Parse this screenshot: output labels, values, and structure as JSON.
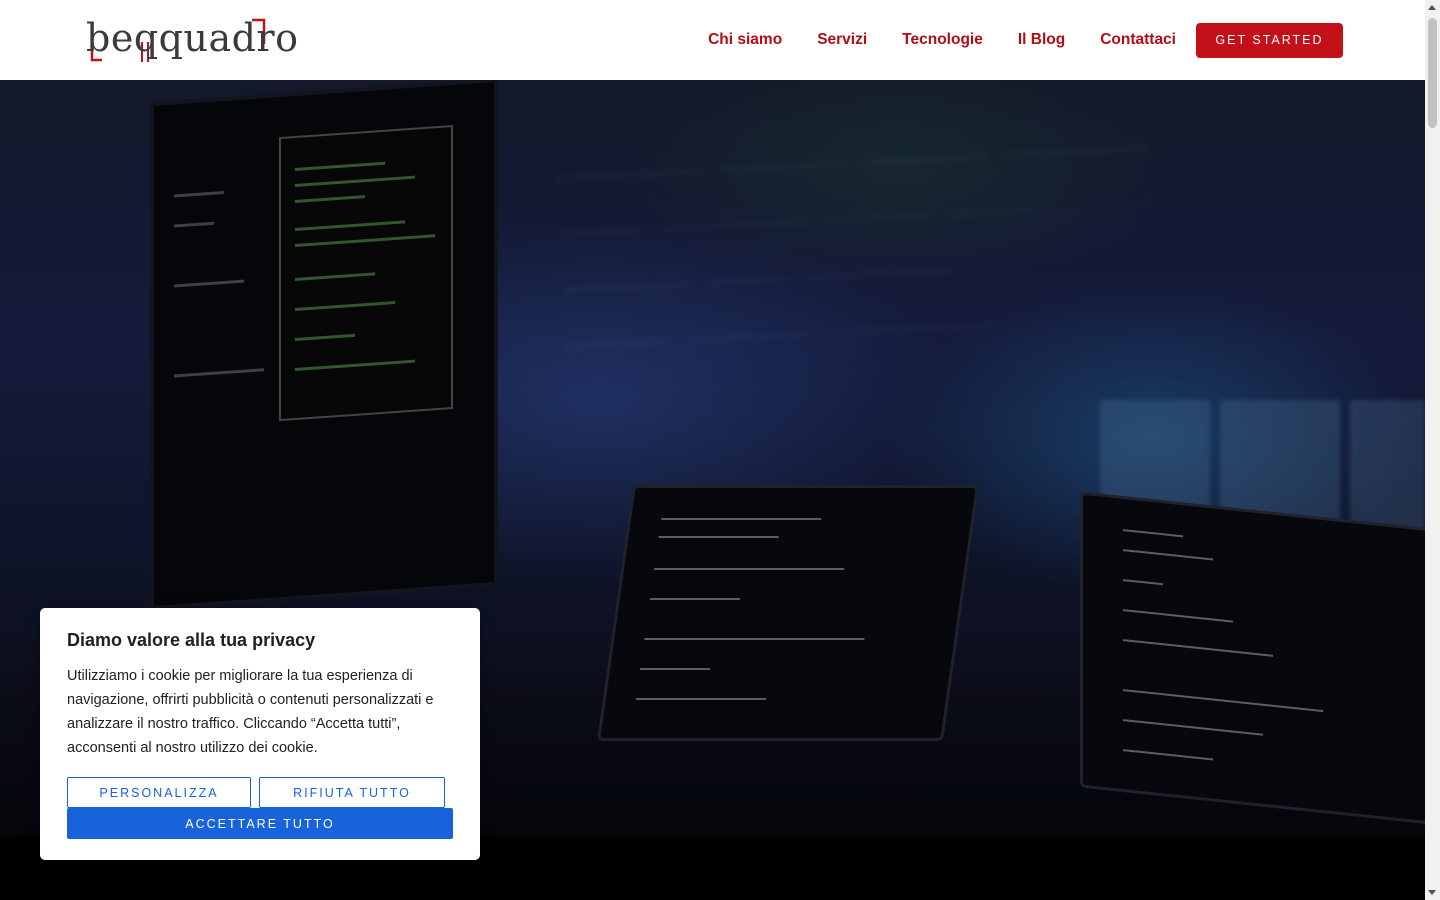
{
  "brand": {
    "logo_text": "beqquadro",
    "accent_color": "#c41018",
    "nav_color": "#b00d16"
  },
  "nav": {
    "items": [
      "Chi siamo",
      "Servizi",
      "Tecnologie",
      "Il Blog",
      "Contattaci"
    ],
    "cta_label": "GET STARTED"
  },
  "hero": {
    "image": "dark office with monitors and laptops displaying code"
  },
  "cookie_banner": {
    "title": "Diamo valore alla tua privacy",
    "body": "Utilizziamo i cookie per migliorare la tua esperienza di navigazione, offrirti pubblicità o contenuti personalizzati e analizzare il nostro traffico. Cliccando “Accetta tutti”, acconsenti al nostro utilizzo dei cookie.",
    "customize_label": "PERSONALIZZA",
    "reject_label": "RIFIUTA TUTTO",
    "accept_label": "ACCETTARE TUTTO",
    "button_color": "#1863dc"
  }
}
